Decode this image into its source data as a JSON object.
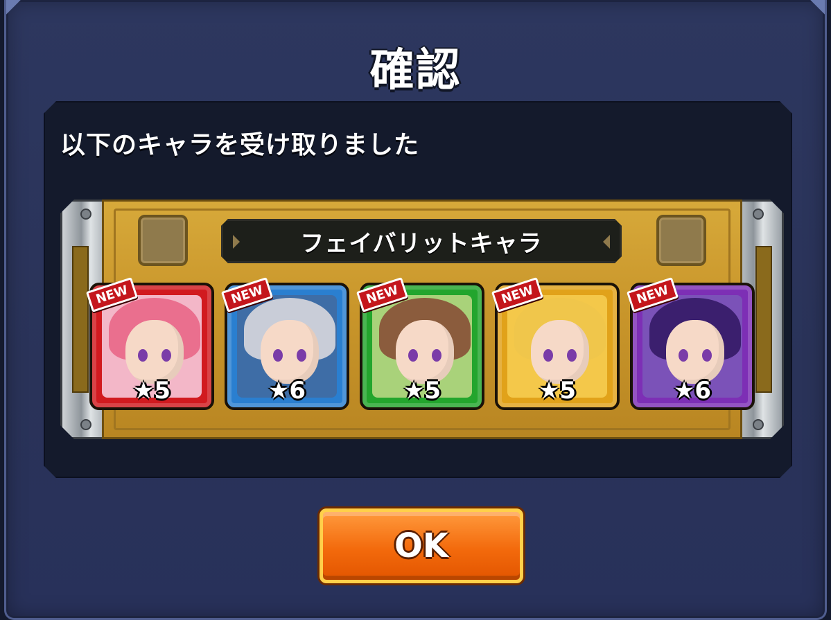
{
  "dialog": {
    "title": "確認",
    "message": "以下のキャラを受け取りました",
    "banner_label": "フェイバリットキャラ",
    "ok_label": "OK"
  },
  "characters": [
    {
      "badge": "NEW",
      "rarity": "★5",
      "frame_color": "#d11a1f",
      "bg_color": "#f3b7c8",
      "hair_color": "#ea6f8e",
      "element": "fire"
    },
    {
      "badge": "NEW",
      "rarity": "★6",
      "frame_color": "#2a7fd0",
      "bg_color": "#3e6da6",
      "hair_color": "#c9cdd8",
      "element": "water"
    },
    {
      "badge": "NEW",
      "rarity": "★5",
      "frame_color": "#23a52d",
      "bg_color": "#a9d27a",
      "hair_color": "#8b5c3d",
      "element": "wood"
    },
    {
      "badge": "NEW",
      "rarity": "★5",
      "frame_color": "#e1a21a",
      "bg_color": "#f4c84a",
      "hair_color": "#f0c64b",
      "element": "light"
    },
    {
      "badge": "NEW",
      "rarity": "★6",
      "frame_color": "#7d2fb5",
      "bg_color": "#7b52b8",
      "hair_color": "#3b1f6e",
      "element": "dark"
    }
  ],
  "colors": {
    "dialog_bg": "#2d375f",
    "gold_frame": "#d7a93a",
    "ok_button": "#f36a0c"
  }
}
